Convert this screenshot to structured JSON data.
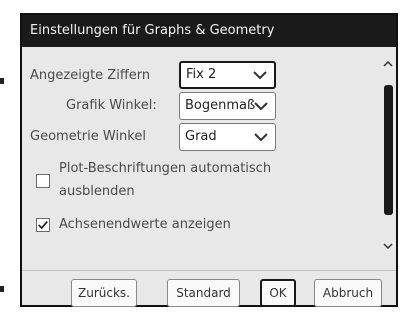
{
  "dialog": {
    "title": "Einstellungen für Graphs & Geometry"
  },
  "settings": {
    "digits_label": "Angezeigte Ziffern",
    "digits_value": "Fix 2",
    "graph_angle_label": "Grafik Winkel:",
    "graph_angle_value": "Bogenmaß",
    "geometry_angle_label": "Geometrie Winkel",
    "geometry_angle_value": "Grad",
    "hide_plot_labels_line1": "Plot-Beschriftungen automatisch",
    "hide_plot_labels_line2": "ausblenden",
    "hide_plot_labels_checked": false,
    "show_axis_end_values": "Achsenendwerte anzeigen",
    "show_axis_end_values_checked": true
  },
  "buttons": {
    "back": "Zurücks.",
    "default": "Standard",
    "ok": "OK",
    "cancel": "Abbruch"
  },
  "icons": {
    "dropdown": "chevron-down-icon",
    "scroll_up": "scroll-up-arrow-icon",
    "scroll_down": "scroll-down-arrow-icon",
    "checkmark": "checkmark-icon"
  }
}
